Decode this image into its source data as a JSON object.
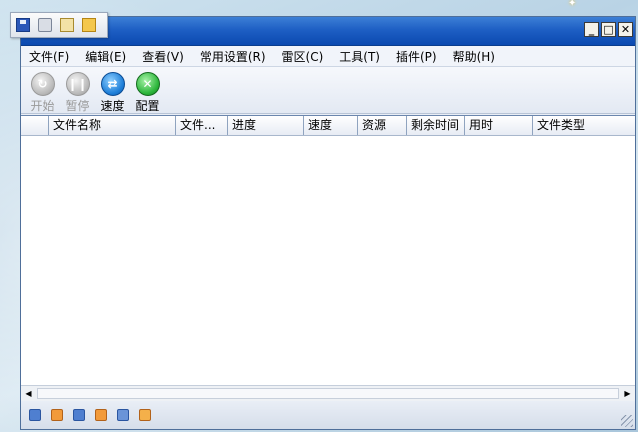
{
  "menubar": {
    "items": [
      {
        "label": "文件(F)"
      },
      {
        "label": "编辑(E)"
      },
      {
        "label": "查看(V)"
      },
      {
        "label": "常用设置(R)"
      },
      {
        "label": "雷区(C)"
      },
      {
        "label": "工具(T)"
      },
      {
        "label": "插件(P)"
      },
      {
        "label": "帮助(H)"
      }
    ]
  },
  "window_controls": {
    "minimize": "_",
    "maximize": "□",
    "close": "✕"
  },
  "toolbar": {
    "start": {
      "label": "开始",
      "icon": "refresh-icon",
      "enabled": false
    },
    "pause": {
      "label": "暂停",
      "icon": "pause-icon",
      "enabled": false
    },
    "speed": {
      "label": "速度",
      "icon": "speed-arrows-icon",
      "enabled": true
    },
    "config": {
      "label": "配置",
      "icon": "config-butterfly-icon",
      "enabled": true
    }
  },
  "table": {
    "columns": [
      "",
      "文件名称",
      "文件...",
      "进度",
      "速度",
      "资源",
      "剩余时间",
      "用时",
      "文件类型"
    ],
    "rows": []
  },
  "statusbar": {
    "icons": [
      "status-r-icon",
      "status-grid-icon",
      "status-info-icon",
      "status-arrow-icon",
      "status-monitor-icon",
      "status-bars-icon"
    ]
  },
  "quickbar": {
    "icons": [
      "save-icon",
      "print-icon",
      "mail-icon",
      "folder-icon"
    ]
  },
  "colors": {
    "titlebar": "#1e5fc4",
    "speed_icon": "#1d7ed8",
    "config_icon": "#2bb53a"
  }
}
